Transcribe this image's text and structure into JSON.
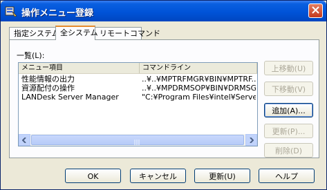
{
  "window": {
    "title": "操作メニュー登録"
  },
  "tabs": [
    {
      "label": "指定システム"
    },
    {
      "label": "全システム"
    },
    {
      "label": "リモートコマンド"
    }
  ],
  "list": {
    "label": "一覧(L):",
    "columns": [
      "メニュー項目",
      "コマンドライン"
    ],
    "rows": [
      {
        "item": "性能情報の出力",
        "command": "..¥..¥MPTRFMGR¥BIN¥MPTRF..."
      },
      {
        "item": "資源配付の操作",
        "command": "..¥..¥MPDRMSOP¥BIN¥DRMSG..."
      },
      {
        "item": "LANDesk Server Manager",
        "command": "\"C:¥Program Files¥intel¥Serve..."
      }
    ]
  },
  "side_buttons": {
    "move_up": "上移動(U)",
    "move_down": "下移動(V)",
    "add": "追加(A)...",
    "update": "更新(P)...",
    "delete": "削除(D)"
  },
  "bottom_buttons": {
    "ok": "OK",
    "cancel": "キャンセル",
    "update": "更新(U)",
    "help": "ヘルプ"
  },
  "colors": {
    "titlebar": "#0054e3",
    "active_tab_accent": "#e68b2c"
  }
}
